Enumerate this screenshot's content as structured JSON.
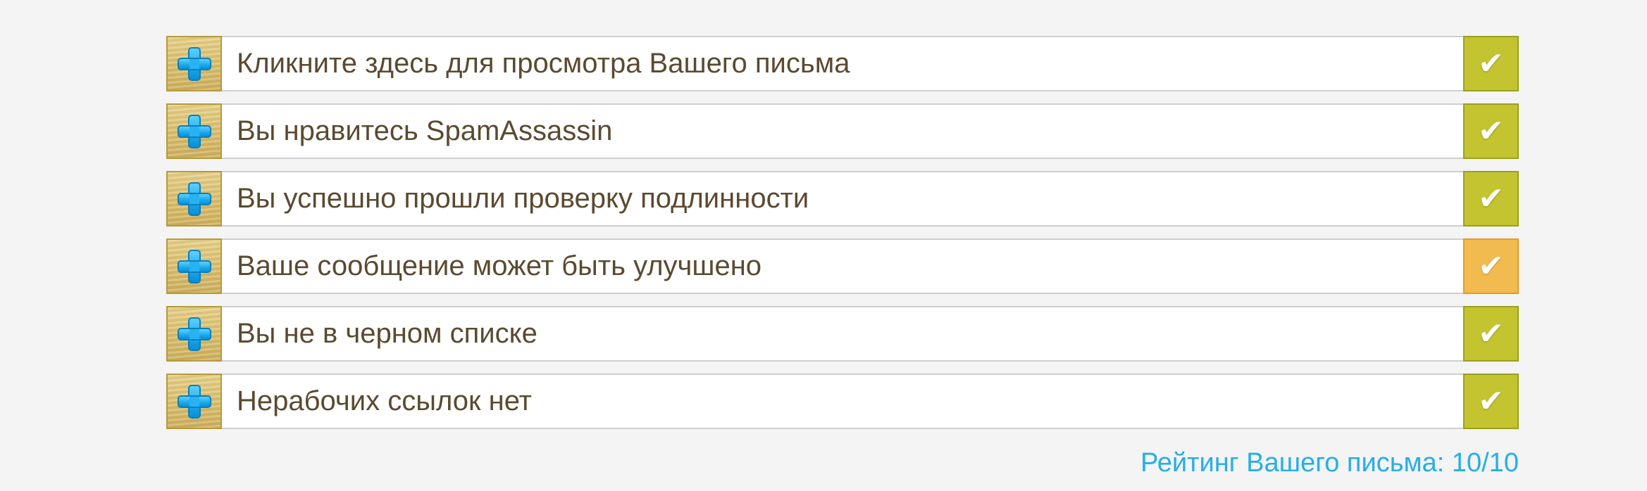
{
  "checks": [
    {
      "label": "Кликните здесь для просмотра Вашего письма",
      "status": "ok",
      "status_color": "#c3c42f"
    },
    {
      "label": "Вы нравитесь SpamAssassin",
      "status": "ok",
      "status_color": "#c3c42f"
    },
    {
      "label": "Вы успешно прошли проверку подлинности",
      "status": "ok",
      "status_color": "#c3c42f"
    },
    {
      "label": "Ваше сообщение может быть улучшено",
      "status": "warning",
      "status_color": "#f2bb4f"
    },
    {
      "label": "Вы не в черном списке",
      "status": "ok",
      "status_color": "#c3c42f"
    },
    {
      "label": "Нерабочих ссылок нет",
      "status": "ok",
      "status_color": "#c3c42f"
    }
  ],
  "icons": {
    "expand": "plus-icon",
    "status": "checkmark-icon",
    "check_glyph": "✔"
  },
  "rating": {
    "text": "Рейтинг Вашего письма: 10/10"
  },
  "colors": {
    "label_text": "#5b4a30",
    "rating_text": "#27aee8",
    "ok": "#c3c42f",
    "warning": "#f2bb4f"
  }
}
